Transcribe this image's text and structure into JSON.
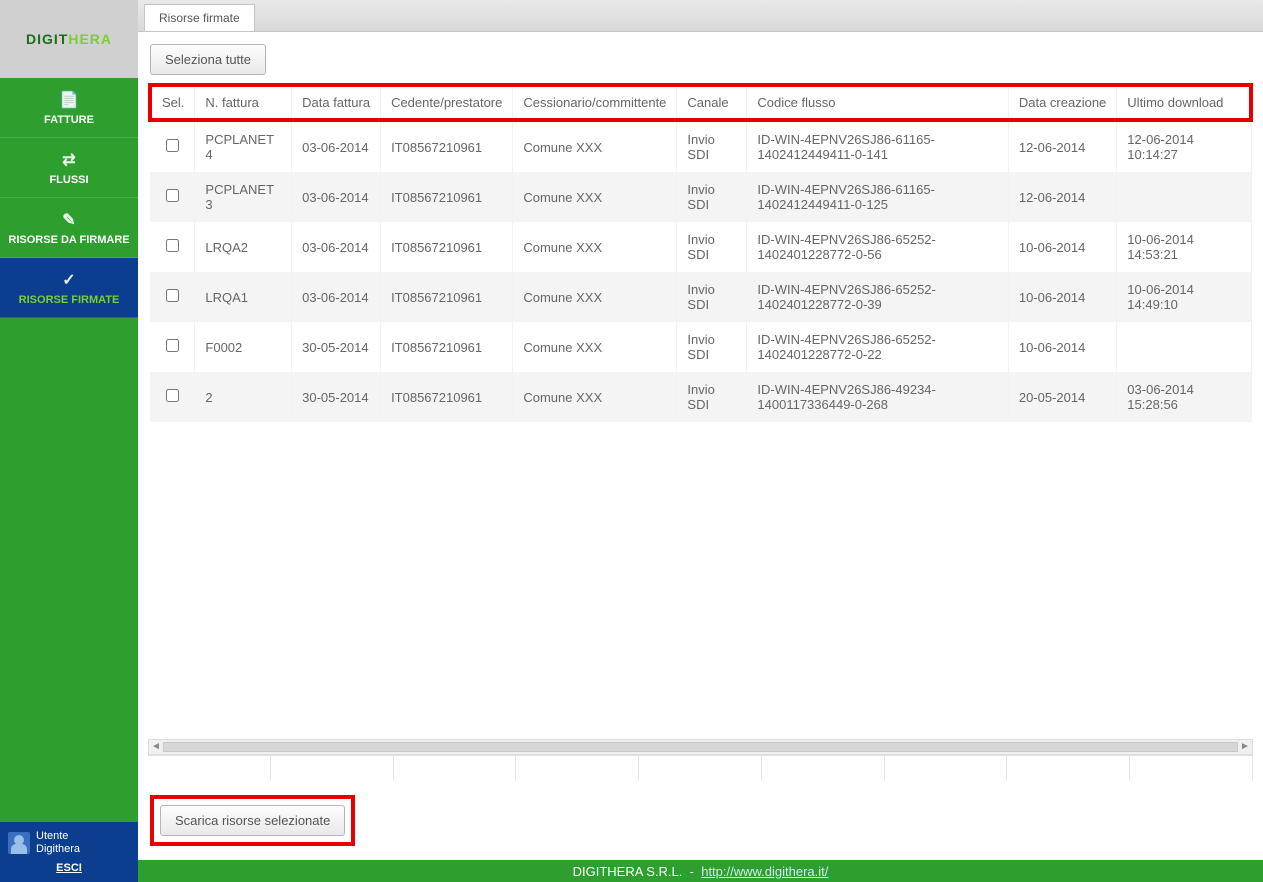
{
  "brand": {
    "part1": "DIGIT",
    "part2": "HERA"
  },
  "sidebar": {
    "items": [
      {
        "label": "FATTURE",
        "icon": "📄"
      },
      {
        "label": "FLUSSI",
        "icon": "⇄"
      },
      {
        "label": "RISORSE DA FIRMARE",
        "icon": "✎"
      },
      {
        "label": "RISORSE FIRMATE",
        "icon": "✓"
      }
    ],
    "active_index": 3,
    "user_line1": "Utente",
    "user_line2": "Digithera",
    "logout": "ESCI"
  },
  "tabs": [
    {
      "label": "Risorse firmate"
    }
  ],
  "toolbar": {
    "select_all": "Seleziona tutte",
    "download_selected": "Scarica risorse selezionate"
  },
  "table": {
    "headers": [
      "Sel.",
      "N. fattura",
      "Data fattura",
      "Cedente/prestatore",
      "Cessionario/committente",
      "Canale",
      "Codice flusso",
      "Data creazione",
      "Ultimo download"
    ],
    "rows": [
      {
        "n": "PCPLANET 4",
        "data": "03-06-2014",
        "ced": "IT08567210961",
        "cess": "Comune XXX",
        "canale": "Invio SDI",
        "flusso": "ID-WIN-4EPNV26SJ86-61165-1402412449411-0-141",
        "crea": "12-06-2014",
        "dl": "12-06-2014 10:14:27"
      },
      {
        "n": "PCPLANET 3",
        "data": "03-06-2014",
        "ced": "IT08567210961",
        "cess": "Comune XXX",
        "canale": "Invio SDI",
        "flusso": "ID-WIN-4EPNV26SJ86-61165-1402412449411-0-125",
        "crea": "12-06-2014",
        "dl": ""
      },
      {
        "n": "LRQA2",
        "data": "03-06-2014",
        "ced": "IT08567210961",
        "cess": "Comune XXX",
        "canale": "Invio SDI",
        "flusso": "ID-WIN-4EPNV26SJ86-65252-1402401228772-0-56",
        "crea": "10-06-2014",
        "dl": "10-06-2014 14:53:21"
      },
      {
        "n": "LRQA1",
        "data": "03-06-2014",
        "ced": "IT08567210961",
        "cess": "Comune XXX",
        "canale": "Invio SDI",
        "flusso": "ID-WIN-4EPNV26SJ86-65252-1402401228772-0-39",
        "crea": "10-06-2014",
        "dl": "10-06-2014 14:49:10"
      },
      {
        "n": "F0002",
        "data": "30-05-2014",
        "ced": "IT08567210961",
        "cess": "Comune XXX",
        "canale": "Invio SDI",
        "flusso": "ID-WIN-4EPNV26SJ86-65252-1402401228772-0-22",
        "crea": "10-06-2014",
        "dl": ""
      },
      {
        "n": "2",
        "data": "30-05-2014",
        "ced": "IT08567210961",
        "cess": "Comune XXX",
        "canale": "Invio SDI",
        "flusso": "ID-WIN-4EPNV26SJ86-49234-1400117336449-0-268",
        "crea": "20-05-2014",
        "dl": "03-06-2014 15:28:56"
      }
    ]
  },
  "footer": {
    "company": "DIGITHERA S.R.L.",
    "sep": "-",
    "url": "http://www.digithera.it/"
  }
}
